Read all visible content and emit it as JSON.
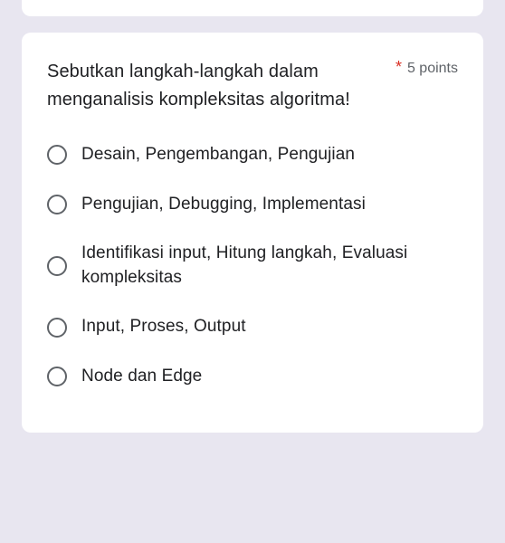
{
  "question": {
    "text": "Sebutkan langkah-langkah dalam menganalisis kompleksitas algoritma!",
    "required_mark": "*",
    "points_label": "5 points"
  },
  "options": [
    {
      "label": "Desain, Pengembangan, Pengujian"
    },
    {
      "label": "Pengujian, Debugging, Implementasi"
    },
    {
      "label": "Identifikasi input, Hitung langkah, Evaluasi kompleksitas"
    },
    {
      "label": "Input, Proses, Output"
    },
    {
      "label": "Node dan Edge"
    }
  ]
}
